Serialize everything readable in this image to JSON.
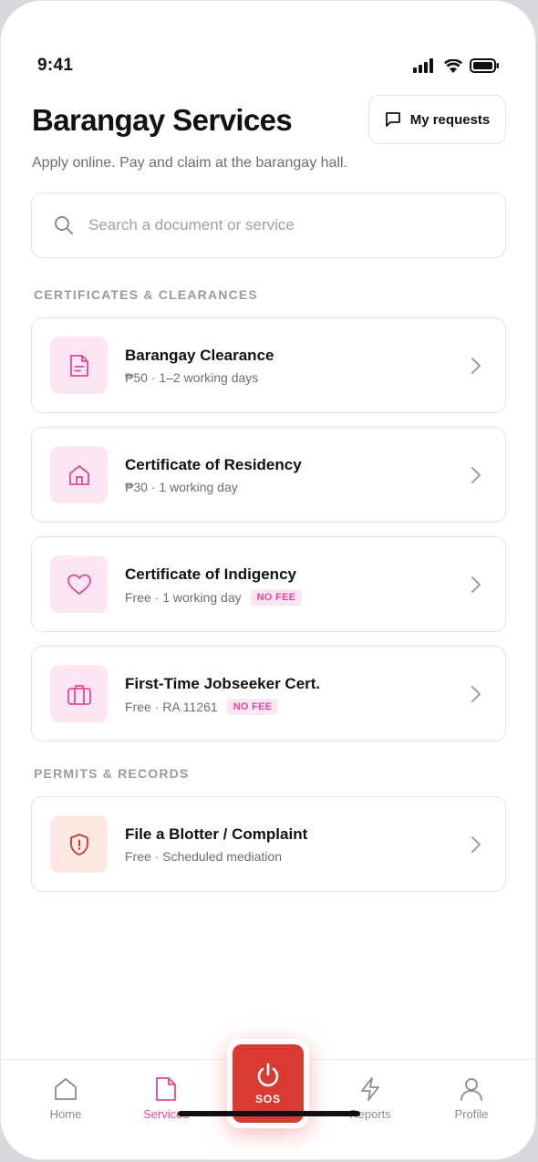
{
  "status_bar": {
    "time": "9:41"
  },
  "header": {
    "title": "Barangay Services",
    "subtitle": "Apply online. Pay and claim at the barangay hall.",
    "requests_button": "My requests"
  },
  "search": {
    "placeholder": "Search a document or service",
    "value": ""
  },
  "sections": [
    {
      "label": "CERTIFICATES & CLEARANCES",
      "items": [
        {
          "name": "Barangay Clearance",
          "meta": "₱50 · 1–2 working days",
          "badge": "",
          "icon": "document-icon"
        },
        {
          "name": "Certificate of Residency",
          "meta": "₱30 · 1 working day",
          "badge": "",
          "icon": "home-icon"
        },
        {
          "name": "Certificate of Indigency",
          "meta": "Free · 1 working day",
          "badge": "NO FEE",
          "icon": "heart-icon"
        },
        {
          "name": "First-Time Jobseeker Cert.",
          "meta": "Free · RA 11261",
          "badge": "NO FEE",
          "icon": "briefcase-icon"
        }
      ]
    },
    {
      "label": "PERMITS & RECORDS",
      "items": [
        {
          "name": "File a Blotter / Complaint",
          "meta": "Free · Scheduled mediation",
          "badge": "",
          "icon": "shield-alert-icon"
        }
      ]
    }
  ],
  "tabbar": {
    "home": "Home",
    "services": "Services",
    "sos": "SOS",
    "reports": "Reports",
    "profile": "Profile",
    "active": "services"
  },
  "colors": {
    "accent": "#e2479a",
    "accent_bg": "#fde6f3",
    "sos": "#d93a32",
    "alert_icon": "#c9372d"
  }
}
